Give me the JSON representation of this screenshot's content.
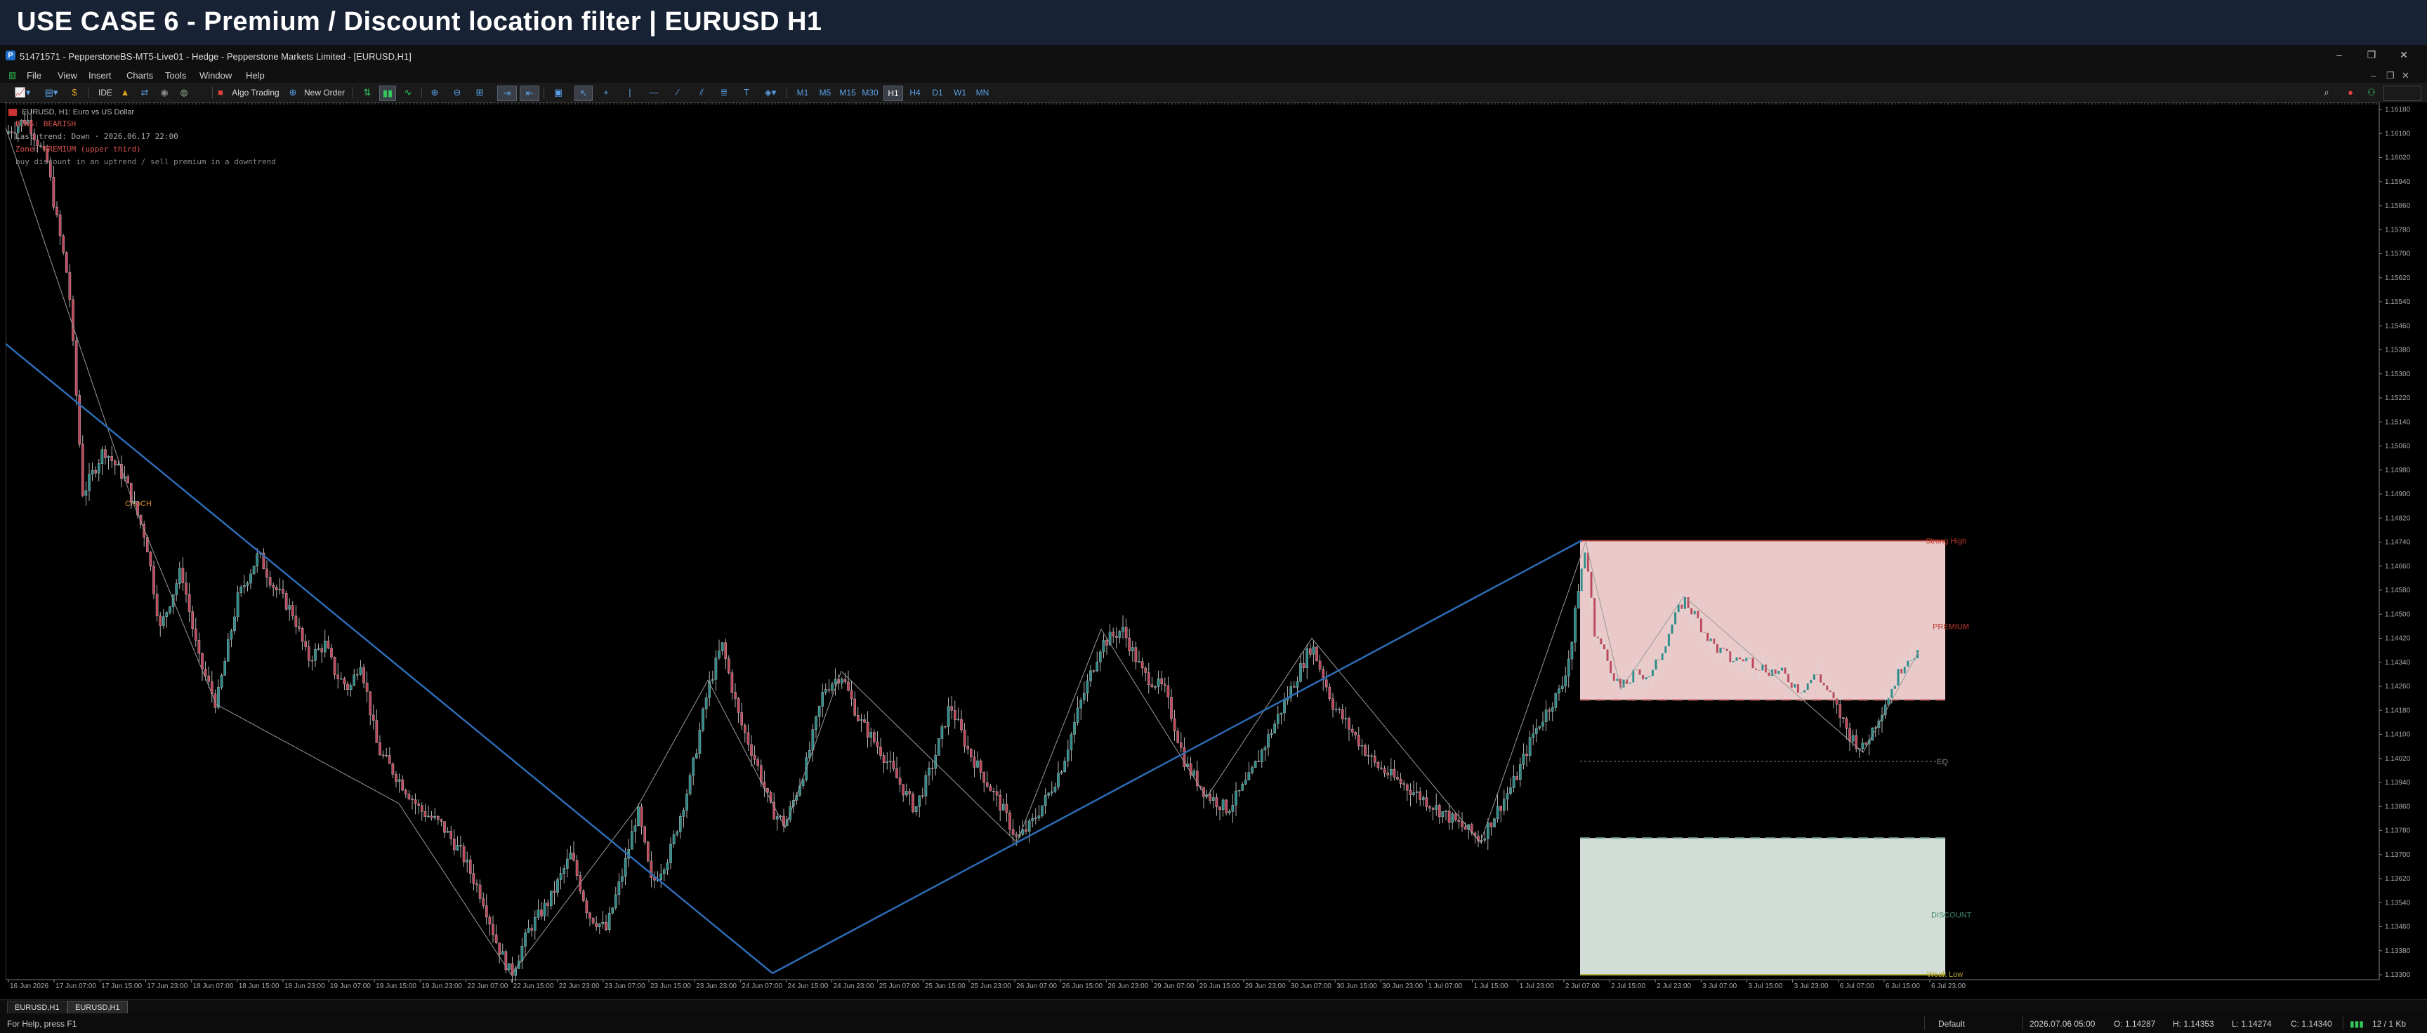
{
  "banner": {
    "text": "USE CASE 6 - Premium / Discount location filter  |  EURUSD H1"
  },
  "window": {
    "title": "51471571 - PepperstoneBS-MT5-Live01 - Hedge - Pepperstone Markets Limited - [EURUSD,H1]",
    "controls": [
      "–",
      "❐",
      "✕"
    ]
  },
  "menu": {
    "items": [
      "File",
      "View",
      "Insert",
      "Charts",
      "Tools",
      "Window",
      "Help"
    ]
  },
  "toolbar": {
    "algo_trading": "Algo Trading",
    "new_order": "New Order",
    "ide": "IDE",
    "timeframes": [
      "M1",
      "M5",
      "M15",
      "M30",
      "H1",
      "H4",
      "D1",
      "W1",
      "MN"
    ],
    "active_timeframe": "H1"
  },
  "chart": {
    "symbol_line": "EURUSD, H1:  Euro vs US Dollar",
    "info_lines": [
      {
        "text": "BIAS: BEARISH",
        "color": "#d9534f"
      },
      {
        "text": "Last trend: Down  · 2026.06.17 22:00",
        "color": "#aaaaaa"
      },
      {
        "text": "Zone: PREMIUM (upper third)",
        "color": "#d9534f"
      },
      {
        "text": "buy discount in an uptrend / sell premium in a downtrend",
        "color": "#888888"
      }
    ],
    "labels": {
      "strong_high": "Strong High",
      "premium": "PREMIUM",
      "eq": "EQ",
      "discount": "DISCOUNT",
      "weak_low": "Weak Low",
      "choch": "CHoCH"
    },
    "colors": {
      "bull": "#2a8b87",
      "bear": "#c0475a",
      "trendline": "#2d6cb6",
      "premium_zone": "#f5d4d4",
      "discount_zone": "#dde9e4",
      "strong_high": "#b03a3a",
      "weak_low": "#b0b03a"
    },
    "price_axis": [
      "1.16180",
      "1.16100",
      "1.16020",
      "1.15940",
      "1.15860",
      "1.15780",
      "1.15700",
      "1.15620",
      "1.15540",
      "1.15460",
      "1.15380",
      "1.15300",
      "1.15220",
      "1.15140",
      "1.15060",
      "1.14980",
      "1.14900",
      "1.14820",
      "1.14740",
      "1.14660",
      "1.14580",
      "1.14500",
      "1.14420",
      "1.14340",
      "1.14260",
      "1.14180",
      "1.14100",
      "1.14020",
      "1.13940",
      "1.13860",
      "1.13780",
      "1.13700",
      "1.13620",
      "1.13540",
      "1.13460",
      "1.13380",
      "1.13300"
    ],
    "time_axis": [
      "16 Jun 2026",
      "17 Jun 07:00",
      "17 Jun 15:00",
      "17 Jun 23:00",
      "18 Jun 07:00",
      "18 Jun 15:00",
      "18 Jun 23:00",
      "19 Jun 07:00",
      "19 Jun 15:00",
      "19 Jun 23:00",
      "22 Jun 07:00",
      "22 Jun 15:00",
      "22 Jun 23:00",
      "23 Jun 07:00",
      "23 Jun 15:00",
      "23 Jun 23:00",
      "24 Jun 07:00",
      "24 Jun 15:00",
      "24 Jun 23:00",
      "25 Jun 07:00",
      "25 Jun 15:00",
      "25 Jun 23:00",
      "26 Jun 07:00",
      "26 Jun 15:00",
      "26 Jun 23:00",
      "29 Jun 07:00",
      "29 Jun 15:00",
      "29 Jun 23:00",
      "30 Jun 07:00",
      "30 Jun 15:00",
      "30 Jun 23:00",
      "1 Jul 07:00",
      "1 Jul 15:00",
      "1 Jul 23:00",
      "2 Jul 07:00",
      "2 Jul 15:00",
      "2 Jul 23:00",
      "3 Jul 07:00",
      "3 Jul 15:00",
      "3 Jul 23:00",
      "6 Jul 07:00",
      "6 Jul 15:00",
      "6 Jul 23:00"
    ]
  },
  "tabs": [
    "EURUSD,H1",
    "EURUSD,H1"
  ],
  "status": {
    "help": "For Help, press F1",
    "profile": "Default",
    "datetime": "2026.07.06 05:00",
    "open": "O: 1.14287",
    "high": "H: 1.14353",
    "low": "L: 1.14274",
    "close": "C: 1.14340",
    "traffic": "12 / 1 Kb"
  }
}
